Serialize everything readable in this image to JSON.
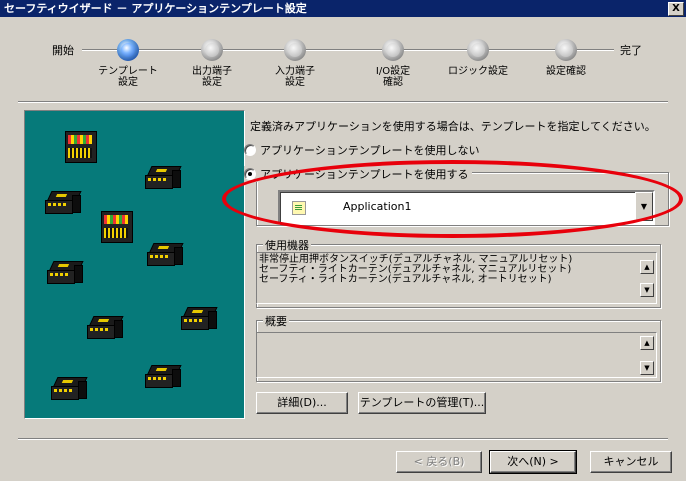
{
  "window": {
    "title": "セーフティウイザード － アプリケーションテンプレート設定",
    "close_symbol": "X"
  },
  "steps": {
    "start_label": "開始",
    "end_label": "完了",
    "items": [
      {
        "label": "テンプレート\n設定",
        "active": true
      },
      {
        "label": "出力端子\n設定",
        "active": false
      },
      {
        "label": "入力端子\n設定",
        "active": false
      },
      {
        "label": "I/O設定\n確認",
        "active": false
      },
      {
        "label": "ロジック設定",
        "active": false
      },
      {
        "label": "設定確認",
        "active": false
      }
    ]
  },
  "main": {
    "description": "定義済みアプリケーションを使用する場合は、テンプレートを指定してください。",
    "radio_no_template": "アプリケーションテンプレートを使用しない",
    "radio_use_template": "アプリケーションテンプレートを使用する",
    "selected_radio": "use_template",
    "template_select_value": "Application1",
    "devices_group_title": "使用機器",
    "devices": [
      "非常停止用押ボタンスイッチ(デュアルチャネル, マニュアルリセット)",
      "セーフティ・ライトカーテン(デュアルチャネル, マニュアルリセット)",
      "セーフティ・ライトカーテン(デュアルチャネル, オートリセット)"
    ],
    "overview_group_title": "概要",
    "overview_text": "",
    "details_button": "詳細(D)...",
    "template_manage_button": "テンプレートの管理(T)..."
  },
  "footer": {
    "back_button": "< 戻る(B)",
    "next_button": "次へ(N) >",
    "cancel_button": "キャンセル"
  },
  "colors": {
    "title_bar": "#0a246a",
    "dialog_bg": "#d4d0c8",
    "image_panel_bg": "#067a7a",
    "highlight_ellipse": "#e8000b"
  }
}
